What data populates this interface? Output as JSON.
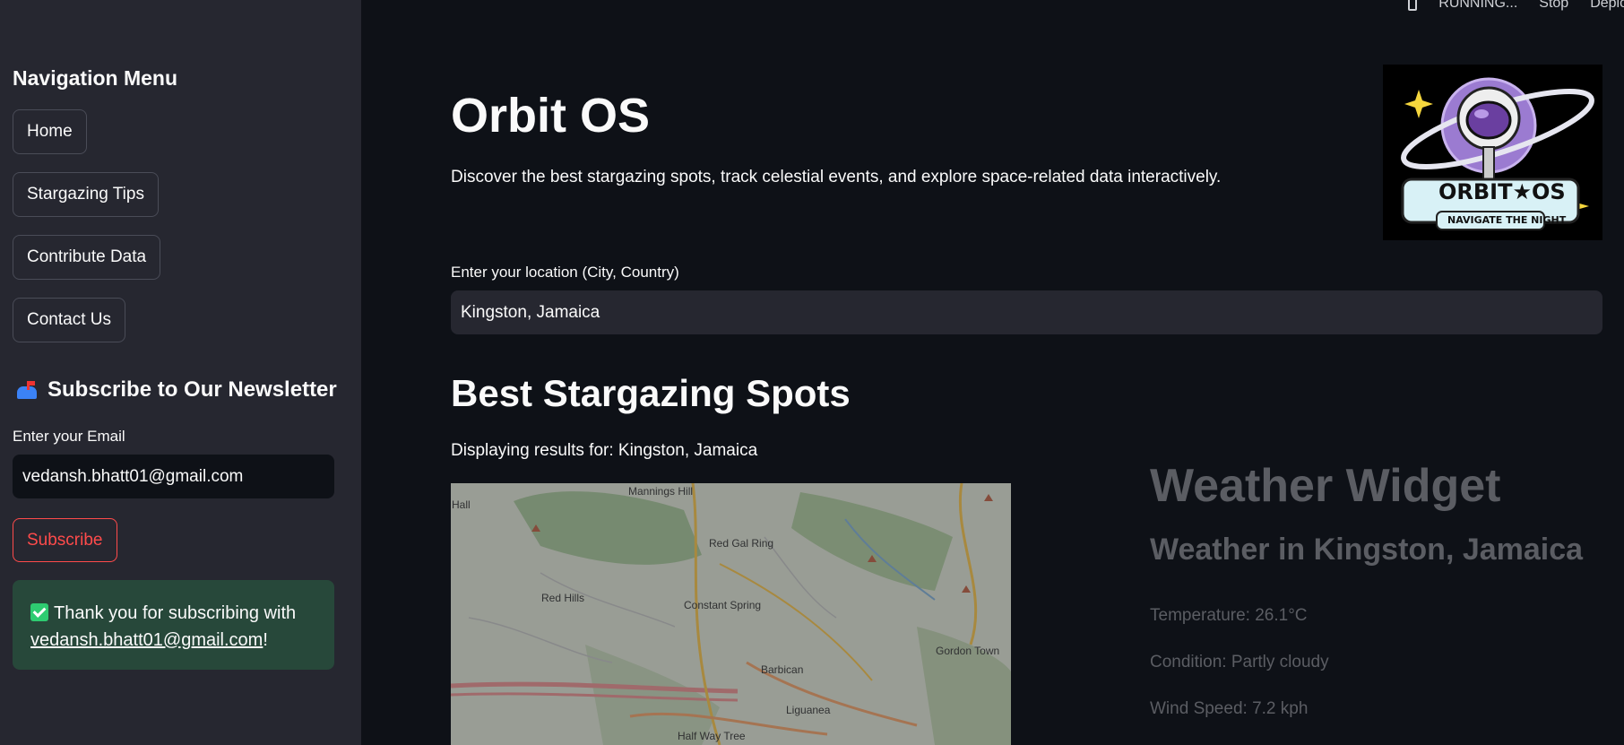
{
  "sidebar": {
    "title": "Navigation Menu",
    "nav_items": [
      {
        "label": "Home"
      },
      {
        "label": "Stargazing Tips"
      },
      {
        "label": "Contribute Data"
      },
      {
        "label": "Contact Us"
      }
    ],
    "newsletter": {
      "title": "Subscribe to Our Newsletter",
      "icon": "mailbox-icon",
      "email_label": "Enter your Email",
      "email_value": "vedansh.bhatt01@gmail.com",
      "subscribe_label": "Subscribe",
      "success_prefix": "Thank you for subscribing with",
      "success_email": "vedansh.bhatt01@gmail.com",
      "success_suffix": "!"
    }
  },
  "topbar": {
    "status": "RUNNING...",
    "stop_label": "Stop",
    "deploy_label": "Deploy"
  },
  "main": {
    "title": "Orbit OS",
    "subtitle": "Discover the best stargazing spots, track celestial events, and explore space-related data interactively.",
    "logo": {
      "text": "ORBIT★OS",
      "tagline": "NAVIGATE THE NIGHT"
    },
    "location_label": "Enter your location (City, Country)",
    "location_value": "Kingston, Jamaica",
    "spots_title": "Best Stargazing Spots",
    "results_text": "Displaying results for: Kingston, Jamaica",
    "map_labels": [
      "Mannings Hill",
      "Red Gal Ring",
      "Red Hills",
      "Constant Spring",
      "Gordon Town",
      "Barbican",
      "Liguanea",
      "Half Way Tree",
      "Hall"
    ]
  },
  "weather": {
    "title": "Weather Widget",
    "subtitle": "Weather in Kingston, Jamaica",
    "temperature": "Temperature: 26.1°C",
    "condition": "Condition: Partly cloudy",
    "wind": "Wind Speed: 7.2 kph"
  },
  "colors": {
    "background": "#0e1117",
    "sidebar": "#262730",
    "accent": "#ff4b4b",
    "success": "#27483a"
  }
}
